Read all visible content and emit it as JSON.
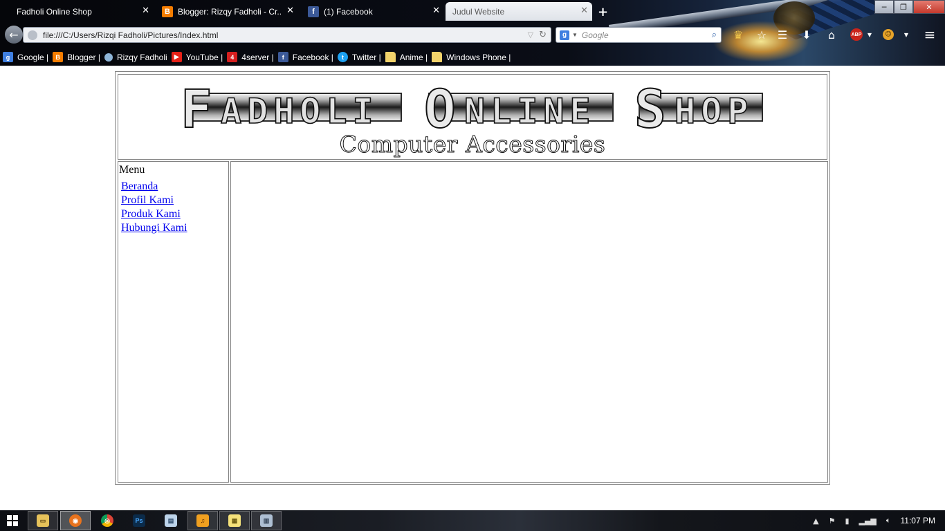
{
  "browser": {
    "window_controls": {
      "minimize": "─",
      "restore": "❐",
      "close": "✕"
    },
    "tabs": [
      {
        "label": "Fadholi Online Shop",
        "favicon": "none",
        "close": "✕"
      },
      {
        "label": "Blogger: Rizqy Fadholi - Cr...",
        "favicon": "blogger-icon",
        "close": "✕"
      },
      {
        "label": "(1) Facebook",
        "favicon": "facebook-icon",
        "close": "✕"
      },
      {
        "label": "Judul Website",
        "favicon": "none",
        "close": "✕"
      }
    ],
    "new_tab": "+",
    "back": "←",
    "url": "file:///C:/Users/Rizqi Fadholi/Pictures/Index.html",
    "search_placeholder": "Google",
    "toolbar": {
      "bookmark_star": "☆",
      "reading_list": "☰",
      "downloads": "⬇",
      "home": "⌂",
      "adblock": "ABP",
      "menu": "≡"
    },
    "bookmarks": [
      {
        "label": "Google |",
        "icon": "google-icon"
      },
      {
        "label": "Blogger |",
        "icon": "blogger-icon"
      },
      {
        "label": "Rizqy Fadholi",
        "icon": "globe-icon"
      },
      {
        "label": "YouTube |",
        "icon": "youtube-icon"
      },
      {
        "label": "4server |",
        "icon": "4server-icon"
      },
      {
        "label": "Facebook |",
        "icon": "facebook-icon"
      },
      {
        "label": "Twitter |",
        "icon": "twitter-icon"
      },
      {
        "label": "Anime |",
        "icon": "folder-icon"
      },
      {
        "label": "Windows Phone |",
        "icon": "folder-icon"
      }
    ]
  },
  "page": {
    "logo_words": [
      {
        "cap": "F",
        "rest": "ADHOLI"
      },
      {
        "cap": "O",
        "rest": "NLINE"
      },
      {
        "cap": "S",
        "rest": "HOP"
      }
    ],
    "subtitle": "Computer Accessories",
    "menu_title": "Menu",
    "menu_items": [
      "Beranda",
      "Profil Kami",
      "Produk Kami",
      "Hubungi Kami"
    ]
  },
  "taskbar": {
    "apps": [
      {
        "name": "file-explorer-icon",
        "glyph": "▭"
      },
      {
        "name": "firefox-icon",
        "glyph": "◉"
      },
      {
        "name": "chrome-icon",
        "glyph": "◎"
      },
      {
        "name": "photoshop-icon",
        "glyph": "Ps"
      },
      {
        "name": "notepad-icon",
        "glyph": "▤"
      },
      {
        "name": "media-player-icon",
        "glyph": "♫"
      },
      {
        "name": "sticky-notes-icon",
        "glyph": "▦"
      },
      {
        "name": "calculator-icon",
        "glyph": "▥"
      }
    ],
    "clock": "11:07 PM"
  },
  "colors": {
    "link": "#0000ee",
    "border": "#808080",
    "blogger": "#f57d00",
    "facebook": "#3b5998",
    "youtube": "#e62117",
    "twitter": "#1da1f2",
    "google": "#3f7fe0",
    "abp": "#c9241b"
  }
}
